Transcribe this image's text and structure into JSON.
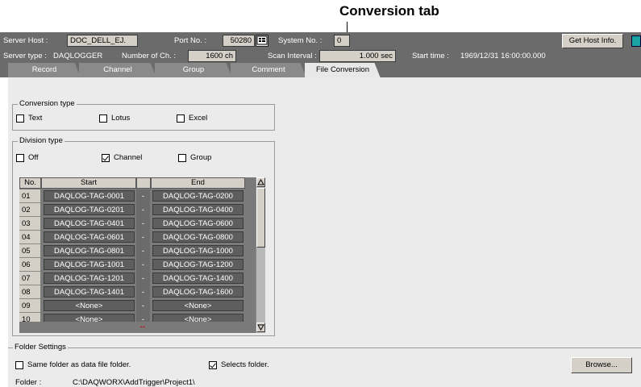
{
  "callout": {
    "label": "Conversion tab"
  },
  "header": {
    "server_host_label": "Server Host :",
    "server_host_value": "DOC_DELL_EJ.",
    "port_label": "Port No. :",
    "port_value": "50280",
    "system_label": "System No. :",
    "system_value": "0",
    "get_host_info_label": "Get Host Info.",
    "server_type_label": "Server type :",
    "server_type_value": "DAQLOGGER",
    "num_ch_label": "Number of Ch. :",
    "num_ch_value": "1600 ch",
    "scan_interval_label": "Scan Interval :",
    "scan_interval_value": "1.000 sec",
    "start_time_label": "Start time :",
    "start_time_value": "1969/12/31 16:00:00.000"
  },
  "tabs": [
    "Record",
    "Channel",
    "Group",
    "Comment",
    "File Conversion"
  ],
  "active_tab": "File Conversion",
  "conversion_type": {
    "title": "Conversion type",
    "options": [
      {
        "label": "Text",
        "checked": false
      },
      {
        "label": "Lotus",
        "checked": false
      },
      {
        "label": "Excel",
        "checked": false
      }
    ]
  },
  "division_type": {
    "title": "Division type",
    "options": [
      {
        "label": "Off",
        "checked": false
      },
      {
        "label": "Channel",
        "checked": true
      },
      {
        "label": "Group",
        "checked": false
      }
    ]
  },
  "table": {
    "headers": {
      "no": "No.",
      "start": "Start",
      "end": "End"
    },
    "rows": [
      {
        "no": "01",
        "start": "DAQLOG-TAG-0001",
        "dash": "-",
        "end": "DAQLOG-TAG-0200"
      },
      {
        "no": "02",
        "start": "DAQLOG-TAG-0201",
        "dash": "-",
        "end": "DAQLOG-TAG-0400"
      },
      {
        "no": "03",
        "start": "DAQLOG-TAG-0401",
        "dash": "-",
        "end": "DAQLOG-TAG-0600"
      },
      {
        "no": "04",
        "start": "DAQLOG-TAG-0601",
        "dash": "-",
        "end": "DAQLOG-TAG-0800"
      },
      {
        "no": "05",
        "start": "DAQLOG-TAG-0801",
        "dash": "-",
        "end": "DAQLOG-TAG-1000"
      },
      {
        "no": "06",
        "start": "DAQLOG-TAG-1001",
        "dash": "-",
        "end": "DAQLOG-TAG-1200"
      },
      {
        "no": "07",
        "start": "DAQLOG-TAG-1201",
        "dash": "-",
        "end": "DAQLOG-TAG-1400"
      },
      {
        "no": "08",
        "start": "DAQLOG-TAG-1401",
        "dash": "-",
        "end": "DAQLOG-TAG-1600"
      },
      {
        "no": "09",
        "start": "<None>",
        "dash": "-",
        "end": "<None>"
      },
      {
        "no": "10",
        "start": "<None>",
        "dash": "-",
        "end": "<None>"
      }
    ],
    "resize_glyph": "↔"
  },
  "folder_settings": {
    "title": "Folder Settings",
    "same_folder_label": "Same folder as data file folder.",
    "same_folder_checked": false,
    "selects_folder_label": "Selects folder.",
    "selects_folder_checked": true,
    "browse_label": "Browse...",
    "folder_label": "Folder :",
    "folder_value": "C:\\DAQWORX\\AddTrigger\\Project1\\"
  },
  "colors": {
    "toolbar": "#6b6b6b",
    "panel": "#ebebeb",
    "cell": "#5e5e5e"
  }
}
